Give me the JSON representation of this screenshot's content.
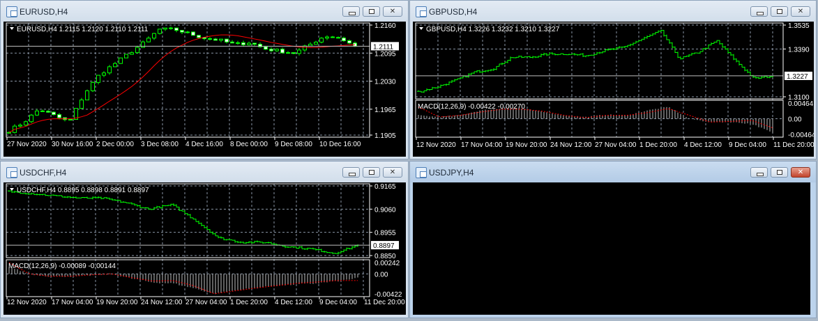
{
  "windows": [
    {
      "id": "eurusd",
      "title": "EURUSD,H4",
      "active": false
    },
    {
      "id": "gbpusd",
      "title": "GBPUSD,H4",
      "active": false
    },
    {
      "id": "usdchf",
      "title": "USDCHF,H4",
      "active": false
    },
    {
      "id": "usdjpy",
      "title": "USDJPY,H4",
      "active": true
    }
  ],
  "colors": {
    "background": "#000000",
    "bars": "#00ff00",
    "bull_body": "#000000",
    "bear_body": "#ffffff",
    "grid": "#8a96a6",
    "ma_line": "#ff0000",
    "macd_hist": "#c0c0c0",
    "macd_signal": "#ff0000"
  },
  "chart_data": [
    {
      "id": "eurusd",
      "type": "candlestick",
      "header": "EURUSD,H4  1.2115 1.2120 1.2110 1.2111",
      "ylim": [
        1.1905,
        1.216
      ],
      "yticks": [
        "1.2160",
        "1.2095",
        "1.2030",
        "1.1965",
        "1.1905"
      ],
      "current_price": "1.2111",
      "xticks": [
        "27 Nov 2020",
        "30 Nov 16:00",
        "2 Dec 00:00",
        "3 Dec 08:00",
        "4 Dec 16:00",
        "8 Dec 00:00",
        "9 Dec 08:00",
        "10 Dec 16:00"
      ],
      "close_anchors": [
        1.1915,
        1.1935,
        1.1965,
        1.195,
        1.1935,
        1.2,
        1.2045,
        1.207,
        1.2095,
        1.212,
        1.215,
        1.215,
        1.214,
        1.213,
        1.2125,
        1.2115,
        1.212,
        1.2105,
        1.21,
        1.2095,
        1.2115,
        1.2135,
        1.213,
        1.2111
      ],
      "moving_average": true
    },
    {
      "id": "gbpusd",
      "type": "ohlc",
      "header": "GBPUSD,H4  1.3226 1.3232 1.3210 1.3227",
      "ylim": [
        1.31,
        1.3535
      ],
      "yticks": [
        "1.3535",
        "1.3390",
        "1.3100"
      ],
      "current_price": "1.3227",
      "xticks": [
        "12 Nov 2020",
        "17 Nov 04:00",
        "19 Nov 20:00",
        "24 Nov 12:00",
        "27 Nov 04:00",
        "1 Dec 20:00",
        "4 Dec 12:00",
        "9 Dec 04:00",
        "11 Dec 20:00"
      ],
      "close_anchors": [
        1.313,
        1.316,
        1.32,
        1.325,
        1.327,
        1.334,
        1.334,
        1.336,
        1.336,
        1.335,
        1.338,
        1.34,
        1.345,
        1.35,
        1.333,
        1.337,
        1.344,
        1.332,
        1.321,
        1.3227
      ],
      "macd": {
        "header": "MACD(12,26,9) -0.00422 -0.00270",
        "ylim": [
          -0.00464,
          0.00464
        ],
        "yticks": [
          "0.00464",
          "0.00",
          "-0.00464"
        ],
        "hist_anchors": [
          0.001,
          0.0005,
          0.001,
          0.0025,
          0.003,
          0.003,
          0.002,
          0.001,
          0.0005,
          0.0012,
          0.001,
          0.0025,
          0.0035,
          0.0,
          -0.001,
          -0.001,
          -0.0015,
          -0.0042
        ],
        "signal_anchors": [
          0.0035,
          0.0005,
          0.001,
          0.002,
          0.0028,
          0.0028,
          0.0022,
          0.001,
          0.0003,
          0.001,
          0.001,
          0.0018,
          0.003,
          0.001,
          -0.001,
          -0.0008,
          -0.0005,
          -0.0027
        ]
      }
    },
    {
      "id": "usdchf",
      "type": "ohlc",
      "header": "USDCHF,H4  0.8895 0.8898 0.8891 0.8897",
      "ylim": [
        0.885,
        0.9165
      ],
      "yticks": [
        "0.9165",
        "0.9060",
        "0.8955",
        "0.8850"
      ],
      "current_price": "0.8897",
      "xticks": [
        "12 Nov 2020",
        "17 Nov 04:00",
        "19 Nov 20:00",
        "24 Nov 12:00",
        "27 Nov 04:00",
        "1 Dec 20:00",
        "4 Dec 12:00",
        "9 Dec 04:00",
        "11 Dec 20:00"
      ],
      "close_anchors": [
        0.914,
        0.913,
        0.912,
        0.911,
        0.911,
        0.909,
        0.906,
        0.908,
        0.901,
        0.893,
        0.891,
        0.891,
        0.889,
        0.888,
        0.886,
        0.8897
      ],
      "macd": {
        "header": "MACD(12,26,9) -0.00089 -0.00144",
        "ylim": [
          -0.00422,
          0.00242
        ],
        "yticks": [
          "0.00242",
          "0.00",
          "-0.00422"
        ],
        "hist_anchors": [
          0.0015,
          0.0,
          -0.0005,
          -0.0005,
          -0.0003,
          0.0,
          -0.001,
          -0.0018,
          -0.002,
          -0.003,
          -0.0042,
          -0.0035,
          -0.003,
          -0.0025,
          -0.0022,
          -0.002,
          -0.0015,
          -0.0009
        ],
        "signal_anchors": [
          0.0024,
          0.0,
          -0.0005,
          -0.0005,
          -0.0002,
          0.0,
          -0.0008,
          -0.0015,
          -0.0014,
          -0.0025,
          -0.0042,
          -0.0036,
          -0.003,
          -0.0025,
          -0.002,
          -0.0017,
          -0.0014,
          -0.0014
        ]
      }
    }
  ]
}
